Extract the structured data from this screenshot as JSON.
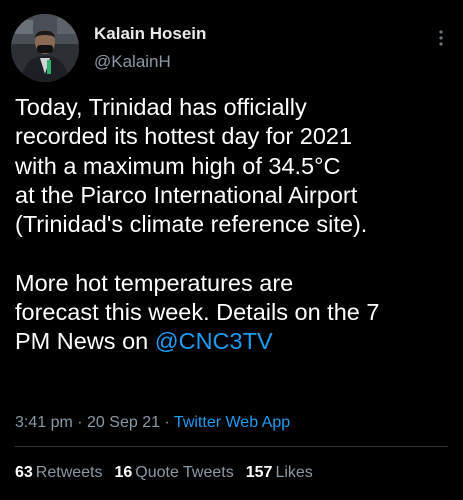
{
  "author": {
    "display_name": "Kalain Hosein",
    "handle": "@KalainH",
    "avatar_icon": "person-avatar-icon"
  },
  "tweet": {
    "paragraph1": [
      "Today, Trinidad has officially",
      "recorded its hottest day for 2021",
      "with a maximum high of 34.5°C",
      "at the Piarco International Airport",
      "(Trinidad's climate reference site)."
    ],
    "paragraph2": [
      "More hot temperatures are",
      "forecast this week. Details on the 7"
    ],
    "paragraph2_last_prefix": "PM News on ",
    "mention": "@CNC3TV"
  },
  "meta": {
    "time": "3:41 pm",
    "separator1": " · ",
    "date": "20 Sep 21",
    "separator2": " · ",
    "source": "Twitter Web App"
  },
  "stats": {
    "retweets_count": "63",
    "retweets_label": "Retweets",
    "quote_count": "16",
    "quote_label": "Quote Tweets",
    "likes_count": "157",
    "likes_label": "Likes"
  },
  "colors": {
    "background": "#000000",
    "text": "#ffffff",
    "secondary_text": "#8b98a5",
    "link": "#1d9bf0",
    "divider": "#2f3336"
  },
  "icons": {
    "more": "more-options-icon"
  }
}
